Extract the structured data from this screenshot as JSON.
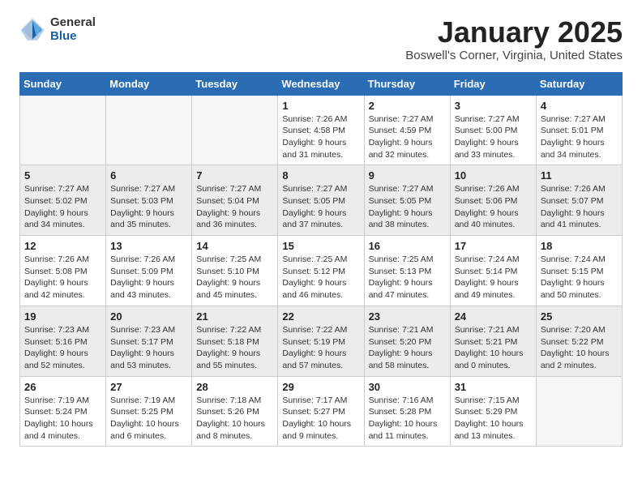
{
  "header": {
    "logo_general": "General",
    "logo_blue": "Blue",
    "title": "January 2025",
    "subtitle": "Boswell's Corner, Virginia, United States"
  },
  "weekdays": [
    "Sunday",
    "Monday",
    "Tuesday",
    "Wednesday",
    "Thursday",
    "Friday",
    "Saturday"
  ],
  "weeks": [
    [
      {
        "day": "",
        "info": ""
      },
      {
        "day": "",
        "info": ""
      },
      {
        "day": "",
        "info": ""
      },
      {
        "day": "1",
        "info": "Sunrise: 7:26 AM\nSunset: 4:58 PM\nDaylight: 9 hours\nand 31 minutes."
      },
      {
        "day": "2",
        "info": "Sunrise: 7:27 AM\nSunset: 4:59 PM\nDaylight: 9 hours\nand 32 minutes."
      },
      {
        "day": "3",
        "info": "Sunrise: 7:27 AM\nSunset: 5:00 PM\nDaylight: 9 hours\nand 33 minutes."
      },
      {
        "day": "4",
        "info": "Sunrise: 7:27 AM\nSunset: 5:01 PM\nDaylight: 9 hours\nand 34 minutes."
      }
    ],
    [
      {
        "day": "5",
        "info": "Sunrise: 7:27 AM\nSunset: 5:02 PM\nDaylight: 9 hours\nand 34 minutes."
      },
      {
        "day": "6",
        "info": "Sunrise: 7:27 AM\nSunset: 5:03 PM\nDaylight: 9 hours\nand 35 minutes."
      },
      {
        "day": "7",
        "info": "Sunrise: 7:27 AM\nSunset: 5:04 PM\nDaylight: 9 hours\nand 36 minutes."
      },
      {
        "day": "8",
        "info": "Sunrise: 7:27 AM\nSunset: 5:05 PM\nDaylight: 9 hours\nand 37 minutes."
      },
      {
        "day": "9",
        "info": "Sunrise: 7:27 AM\nSunset: 5:05 PM\nDaylight: 9 hours\nand 38 minutes."
      },
      {
        "day": "10",
        "info": "Sunrise: 7:26 AM\nSunset: 5:06 PM\nDaylight: 9 hours\nand 40 minutes."
      },
      {
        "day": "11",
        "info": "Sunrise: 7:26 AM\nSunset: 5:07 PM\nDaylight: 9 hours\nand 41 minutes."
      }
    ],
    [
      {
        "day": "12",
        "info": "Sunrise: 7:26 AM\nSunset: 5:08 PM\nDaylight: 9 hours\nand 42 minutes."
      },
      {
        "day": "13",
        "info": "Sunrise: 7:26 AM\nSunset: 5:09 PM\nDaylight: 9 hours\nand 43 minutes."
      },
      {
        "day": "14",
        "info": "Sunrise: 7:25 AM\nSunset: 5:10 PM\nDaylight: 9 hours\nand 45 minutes."
      },
      {
        "day": "15",
        "info": "Sunrise: 7:25 AM\nSunset: 5:12 PM\nDaylight: 9 hours\nand 46 minutes."
      },
      {
        "day": "16",
        "info": "Sunrise: 7:25 AM\nSunset: 5:13 PM\nDaylight: 9 hours\nand 47 minutes."
      },
      {
        "day": "17",
        "info": "Sunrise: 7:24 AM\nSunset: 5:14 PM\nDaylight: 9 hours\nand 49 minutes."
      },
      {
        "day": "18",
        "info": "Sunrise: 7:24 AM\nSunset: 5:15 PM\nDaylight: 9 hours\nand 50 minutes."
      }
    ],
    [
      {
        "day": "19",
        "info": "Sunrise: 7:23 AM\nSunset: 5:16 PM\nDaylight: 9 hours\nand 52 minutes."
      },
      {
        "day": "20",
        "info": "Sunrise: 7:23 AM\nSunset: 5:17 PM\nDaylight: 9 hours\nand 53 minutes."
      },
      {
        "day": "21",
        "info": "Sunrise: 7:22 AM\nSunset: 5:18 PM\nDaylight: 9 hours\nand 55 minutes."
      },
      {
        "day": "22",
        "info": "Sunrise: 7:22 AM\nSunset: 5:19 PM\nDaylight: 9 hours\nand 57 minutes."
      },
      {
        "day": "23",
        "info": "Sunrise: 7:21 AM\nSunset: 5:20 PM\nDaylight: 9 hours\nand 58 minutes."
      },
      {
        "day": "24",
        "info": "Sunrise: 7:21 AM\nSunset: 5:21 PM\nDaylight: 10 hours\nand 0 minutes."
      },
      {
        "day": "25",
        "info": "Sunrise: 7:20 AM\nSunset: 5:22 PM\nDaylight: 10 hours\nand 2 minutes."
      }
    ],
    [
      {
        "day": "26",
        "info": "Sunrise: 7:19 AM\nSunset: 5:24 PM\nDaylight: 10 hours\nand 4 minutes."
      },
      {
        "day": "27",
        "info": "Sunrise: 7:19 AM\nSunset: 5:25 PM\nDaylight: 10 hours\nand 6 minutes."
      },
      {
        "day": "28",
        "info": "Sunrise: 7:18 AM\nSunset: 5:26 PM\nDaylight: 10 hours\nand 8 minutes."
      },
      {
        "day": "29",
        "info": "Sunrise: 7:17 AM\nSunset: 5:27 PM\nDaylight: 10 hours\nand 9 minutes."
      },
      {
        "day": "30",
        "info": "Sunrise: 7:16 AM\nSunset: 5:28 PM\nDaylight: 10 hours\nand 11 minutes."
      },
      {
        "day": "31",
        "info": "Sunrise: 7:15 AM\nSunset: 5:29 PM\nDaylight: 10 hours\nand 13 minutes."
      },
      {
        "day": "",
        "info": ""
      }
    ]
  ]
}
